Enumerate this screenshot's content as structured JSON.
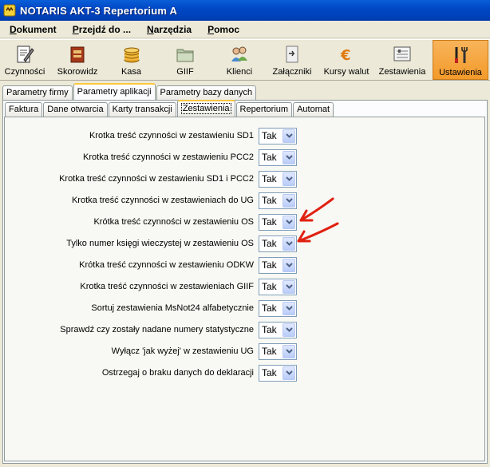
{
  "window": {
    "title": "NOTARIS AKT-3 Repertorium A"
  },
  "menu": [
    {
      "label": "Dokument",
      "underline": "D",
      "rest": "okument"
    },
    {
      "label": "Przejdź do ...",
      "underline": "P",
      "rest": "rzejdź do ..."
    },
    {
      "label": "Narzędzia",
      "underline": "N",
      "rest": "arzędzia"
    },
    {
      "label": "Pomoc",
      "underline": "P",
      "rest": "omoc"
    }
  ],
  "toolbar": [
    {
      "label": "Czynności",
      "icon": "document-edit-icon"
    },
    {
      "label": "Skorowidz",
      "icon": "book-icon"
    },
    {
      "label": "Kasa",
      "icon": "coins-icon"
    },
    {
      "label": "GIIF",
      "icon": "folder-icon"
    },
    {
      "label": "Klienci",
      "icon": "people-icon"
    },
    {
      "label": "Załączniki",
      "icon": "attachment-icon"
    },
    {
      "label": "Kursy walut",
      "icon": "euro-icon"
    },
    {
      "label": "Zestawienia",
      "icon": "report-icon"
    },
    {
      "label": "Ustawienia",
      "icon": "tools-icon",
      "active": true
    }
  ],
  "tabs_top": [
    "Parametry firmy",
    "Parametry aplikacji",
    "Parametry bazy danych"
  ],
  "tabs_top_selected": "Parametry aplikacji",
  "tabs_inner": [
    "Faktura",
    "Dane otwarcia",
    "Karty transakcji",
    "Zestawienia",
    "Repertorium",
    "Automat"
  ],
  "tabs_inner_selected": "Zestawienia",
  "settings": [
    {
      "label": "Krotka treść czynności w zestawieniu SD1",
      "value": "Tak"
    },
    {
      "label": "Krotka treść czynności w zestawieniu PCC2",
      "value": "Tak"
    },
    {
      "label": "Krotka treść czynności w zestawieniu SD1 i PCC2",
      "value": "Tak"
    },
    {
      "label": "Krotka treść czynności w zestawieniach do UG",
      "value": "Tak"
    },
    {
      "label": "Krótka treść czynności w zestawieniu OS",
      "value": "Tak"
    },
    {
      "label": "Tylko numer księgi wieczystej w zestawieniu OS",
      "value": "Tak"
    },
    {
      "label": "Krótka treść czynności w zestawieniu ODKW",
      "value": "Tak"
    },
    {
      "label": "Krotka treść czynności w zestawieniach GIIF",
      "value": "Tak"
    },
    {
      "label": "Sortuj zestawienia MsNot24 alfabetycznie",
      "value": "Tak"
    },
    {
      "label": "Sprawdź czy zostały nadane numery statystyczne",
      "value": "Tak"
    },
    {
      "label": "Wyłącz 'jak wyżej' w zestawieniu UG",
      "value": "Tak"
    },
    {
      "label": "Ostrzegaj o braku danych do deklaracji",
      "value": "Tak"
    }
  ],
  "colors": {
    "title_bar": "#0048c4",
    "active_tool": "#f39a2b",
    "annotation_arrow": "#e02010"
  }
}
